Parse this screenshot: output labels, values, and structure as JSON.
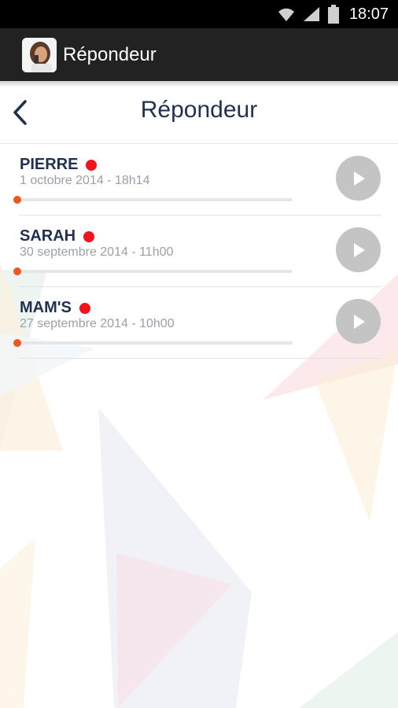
{
  "status_bar": {
    "time": "18:07",
    "icons": [
      "wifi-icon",
      "signal-icon",
      "battery-icon"
    ]
  },
  "action_bar": {
    "title": "Répondeur",
    "icon": "app-avatar-icon",
    "background": "#222222"
  },
  "header": {
    "title": "Répondeur",
    "back_icon": "chevron-left-icon"
  },
  "colors": {
    "title_text": "#1f3150",
    "unread_dot": "#f0141b",
    "progress": "#f0561e",
    "play_button": "#c4c4c4"
  },
  "messages": [
    {
      "name": "PIERRE",
      "date": "1 octobre 2014 - 18h14",
      "unread": true,
      "progress": 0
    },
    {
      "name": "SARAH",
      "date": "30 septembre 2014 - 11h00",
      "unread": true,
      "progress": 0
    },
    {
      "name": "MAM'S",
      "date": "27 septembre 2014 - 10h00",
      "unread": true,
      "progress": 0
    }
  ]
}
